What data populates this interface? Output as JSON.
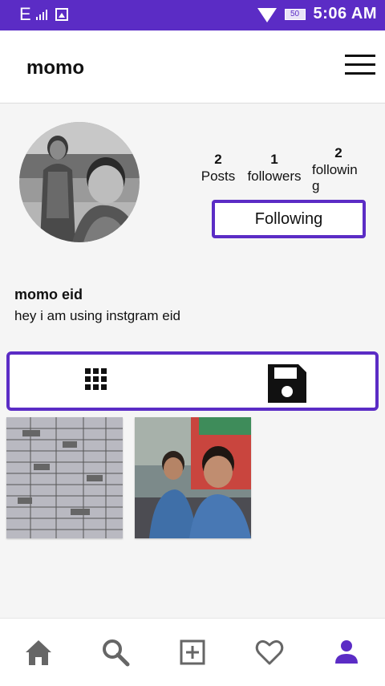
{
  "status_bar": {
    "network": "E",
    "battery": "50",
    "time": "5:06 AM",
    "icons": [
      "signal-icon",
      "image-icon",
      "wifi-icon",
      "battery-icon"
    ]
  },
  "app_bar": {
    "title": "momo",
    "menu_icon": "menu-icon"
  },
  "profile": {
    "stats": [
      {
        "number": "2",
        "label": "Posts"
      },
      {
        "number": "1",
        "label": "followers"
      },
      {
        "number": "2",
        "label": "followin g"
      }
    ],
    "following_button": "Following",
    "name": "momo eid",
    "bio": "hey i am using instgram eid"
  },
  "tabs": [
    {
      "icon": "grid-icon"
    },
    {
      "icon": "save-icon"
    }
  ],
  "posts": [
    {
      "kind": "document-photo"
    },
    {
      "kind": "selfie-photo"
    }
  ],
  "bottom_nav": [
    {
      "icon": "home-icon"
    },
    {
      "icon": "search-icon"
    },
    {
      "icon": "add-post-icon"
    },
    {
      "icon": "heart-icon"
    },
    {
      "icon": "profile-icon"
    }
  ],
  "colors": {
    "accent": "#5b2cc5",
    "background": "#f5f5f5",
    "text": "#111111",
    "nav_icon": "#666666"
  }
}
